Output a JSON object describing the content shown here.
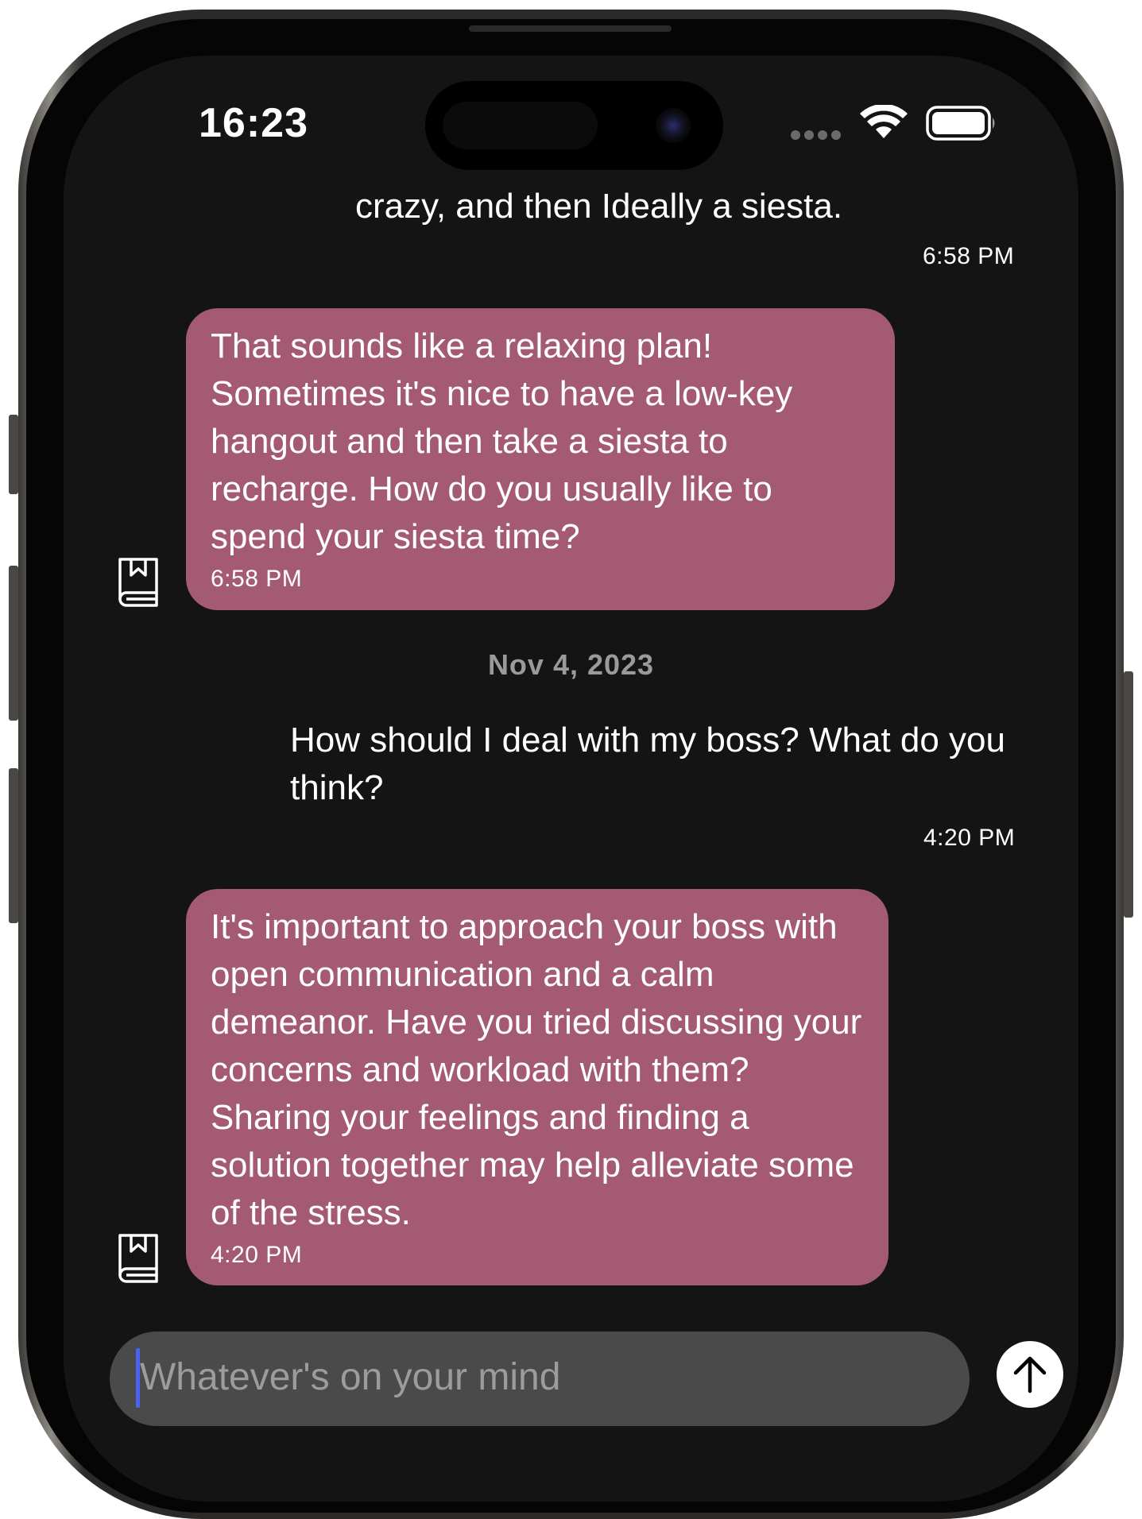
{
  "status_bar": {
    "time": "16:23"
  },
  "conversation": {
    "partial_user_message": {
      "text": "crazy, and then Ideally a siesta.",
      "time": "6:58 PM"
    },
    "reply_1": {
      "text": "That sounds like a relaxing plan! Sometimes it's nice to have a low-key hangout and then take a siesta to recharge. How do you usually like to spend your siesta time?",
      "time": "6:58 PM",
      "icon": "bookmark-book-icon"
    },
    "date_separator": "Nov 4, 2023",
    "user_message_2": {
      "text": "How should I deal with my boss? What do you think?",
      "time": "4:20 PM"
    },
    "reply_2": {
      "text": "It's important to approach your boss with open communication and a calm demeanor. Have you tried discussing your concerns and workload with them? Sharing your feelings and finding a solution together may help alleviate some of the stress.",
      "time": "4:20 PM",
      "icon": "bookmark-book-icon"
    }
  },
  "composer": {
    "placeholder": "Whatever's on your mind",
    "send_icon": "arrow-up-icon"
  },
  "colors": {
    "background": "#141414",
    "assistant_bubble": "#a45a72",
    "input_field": "#4a4a4a",
    "caret": "#4b63f5"
  }
}
